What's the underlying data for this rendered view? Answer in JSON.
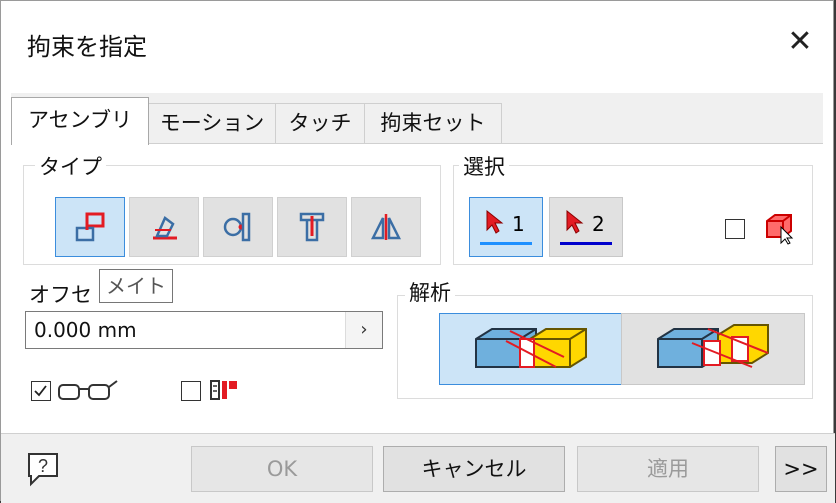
{
  "window": {
    "title": "拘束を指定",
    "close_label": "✕"
  },
  "tabs": [
    {
      "label": "アセンブリ",
      "active": true
    },
    {
      "label": "モーション",
      "active": false
    },
    {
      "label": "タッチ",
      "active": false
    },
    {
      "label": "拘束セット",
      "active": false
    }
  ],
  "type_group": {
    "title": "タイプ",
    "buttons": [
      {
        "icon": "mate-icon",
        "selected": true
      },
      {
        "icon": "angle-icon",
        "selected": false
      },
      {
        "icon": "tangent-icon",
        "selected": false
      },
      {
        "icon": "insert-icon",
        "selected": false
      },
      {
        "icon": "symmetry-icon",
        "selected": false
      }
    ]
  },
  "selection_group": {
    "title": "選択",
    "select1_label": "1",
    "select2_label": "2",
    "first_selection_icon": "part-select-icon",
    "first_selection_checked": false
  },
  "offset": {
    "label": "オフセ",
    "value": "0.000 mm",
    "arrow": "›",
    "tooltip": "メイト"
  },
  "options": {
    "preview_checked": true,
    "preview_icon": "glasses-icon",
    "predict_checked": false,
    "predict_icon": "predict-offset-icon"
  },
  "analysis_group": {
    "title": "解析",
    "buttons": [
      {
        "icon": "solution-mate-icon",
        "selected": true
      },
      {
        "icon": "solution-flush-icon",
        "selected": false
      }
    ]
  },
  "footer": {
    "help_icon": "help-icon",
    "ok_label": "OK",
    "cancel_label": "キャンセル",
    "apply_label": "適用",
    "more_label": ">>"
  },
  "colors": {
    "accent": "#3b8ddd",
    "selected_bg": "#cce4f7",
    "red": "#e31b23",
    "blue_line1": "#1e90ff",
    "blue_line2": "#0000cc"
  }
}
